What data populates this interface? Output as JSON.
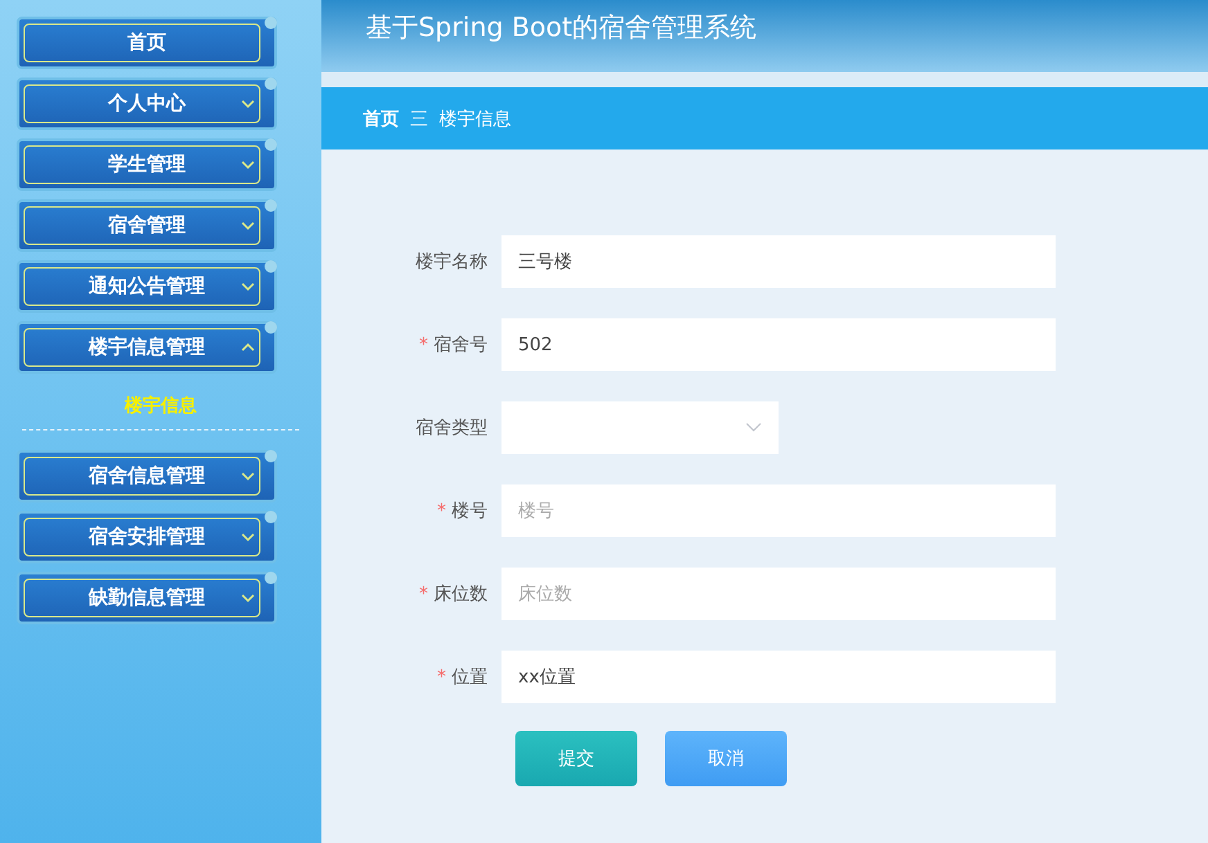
{
  "header": {
    "title": "基于Spring Boot的宿舍管理系统"
  },
  "breadcrumb": {
    "items": [
      "首页",
      "楼宇信息"
    ],
    "separator": "三"
  },
  "sidebar": {
    "items": [
      {
        "label": "首页",
        "kind": "link"
      },
      {
        "label": "个人中心",
        "kind": "menu",
        "expanded": false
      },
      {
        "label": "学生管理",
        "kind": "menu",
        "expanded": false
      },
      {
        "label": "宿舍管理",
        "kind": "menu",
        "expanded": false
      },
      {
        "label": "通知公告管理",
        "kind": "menu",
        "expanded": false
      },
      {
        "label": "楼宇信息管理",
        "kind": "menu",
        "expanded": true,
        "children": [
          {
            "label": "楼宇信息",
            "selected": true
          }
        ]
      },
      {
        "label": "宿舍信息管理",
        "kind": "menu",
        "expanded": false
      },
      {
        "label": "宿舍安排管理",
        "kind": "menu",
        "expanded": false
      },
      {
        "label": "缺勤信息管理",
        "kind": "menu",
        "expanded": false
      }
    ]
  },
  "form": {
    "fields": [
      {
        "label": "楼宇名称",
        "kind": "text",
        "value": "三号楼"
      },
      {
        "label": "宿舍号",
        "kind": "text",
        "required_mark": "*",
        "value": "502"
      },
      {
        "label": "宿舍类型",
        "kind": "select"
      },
      {
        "label": "楼号",
        "kind": "text",
        "required_mark": "*",
        "placeholder": "楼号"
      },
      {
        "label": "床位数",
        "kind": "text",
        "required_mark": "*",
        "placeholder": "床位数"
      },
      {
        "label": "位置",
        "kind": "text",
        "required_mark": "*",
        "value": "xx位置"
      }
    ],
    "buttons": [
      {
        "label": "提交",
        "kind": "primary"
      },
      {
        "label": "取消",
        "kind": "secondary"
      }
    ]
  }
}
